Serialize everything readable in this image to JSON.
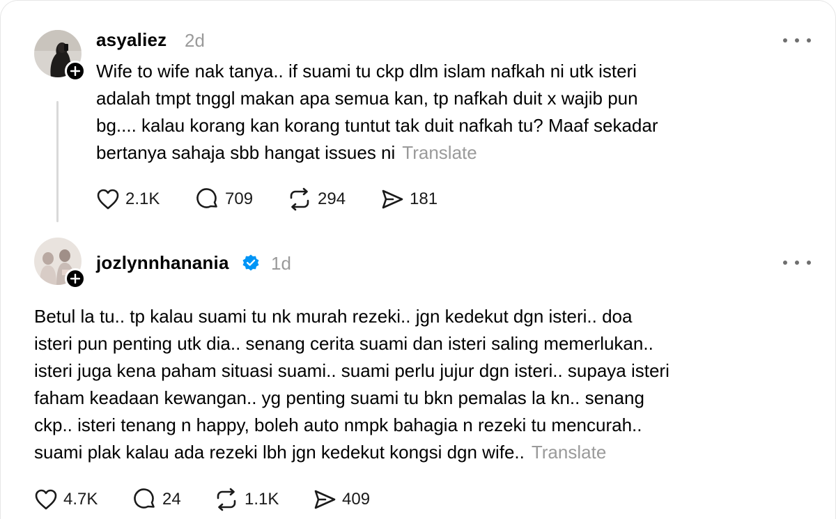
{
  "posts": [
    {
      "username": "asyaliez",
      "time": "2d",
      "verified": false,
      "lines": [
        "Wife to wife nak tanya.. if suami tu ckp dlm islam nafkah ni utk isteri",
        "adalah tmpt tnggl makan apa semua kan, tp nafkah duit x wajib pun",
        "bg.... kalau korang kan korang tuntut tak duit nafkah tu? Maaf sekadar",
        "bertanya sahaja sbb hangat issues ni"
      ],
      "translate_label": "Translate",
      "likes": "2.1K",
      "replies": "709",
      "reposts": "294",
      "shares": "181"
    },
    {
      "username": "jozlynnhanania",
      "time": "1d",
      "verified": true,
      "lines": [
        "Betul la tu.. tp kalau suami tu nk murah rezeki.. jgn kedekut dgn isteri.. doa",
        "isteri pun penting utk dia.. senang cerita suami dan isteri saling memerlukan..",
        "isteri juga kena paham situasi suami.. suami perlu jujur dgn isteri.. supaya isteri",
        "faham keadaan kewangan.. yg penting suami tu bkn pemalas la kn.. senang",
        "ckp.. isteri tenang n happy, boleh auto nmpk bahagia n rezeki tu mencurah..",
        "suami plak kalau ada rezeki lbh jgn kedekut kongsi dgn wife.."
      ],
      "translate_label": "Translate",
      "likes": "4.7K",
      "replies": "24",
      "reposts": "1.1K",
      "shares": "409"
    }
  ],
  "icons": {
    "like": "heart-icon",
    "reply": "comment-icon",
    "repost": "repost-icon",
    "share": "send-icon",
    "more": "more-icon",
    "follow": "plus-icon",
    "verified": "verified-badge-icon"
  },
  "colors": {
    "text": "#000000",
    "muted": "#9a9a9a",
    "verified": "#0095f6",
    "thread_line": "#d9d9d9"
  }
}
